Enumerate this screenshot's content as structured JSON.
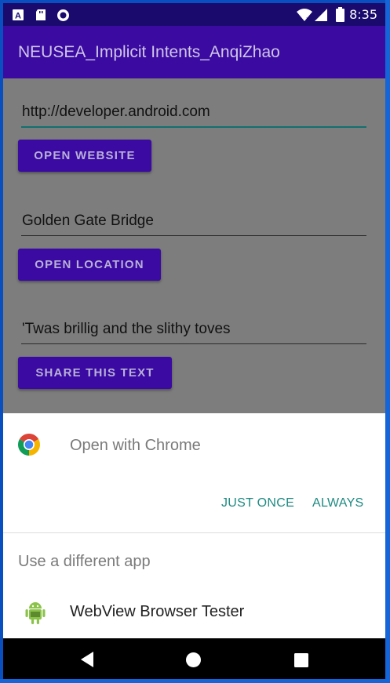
{
  "status_bar": {
    "time": "8:35",
    "icons": [
      "notification-a-icon",
      "sd-card-icon",
      "sync-circle-icon",
      "wifi-icon",
      "signal-icon",
      "battery-icon"
    ]
  },
  "app_bar": {
    "title": "NEUSEA_Implicit Intents_AnqiZhao"
  },
  "main": {
    "website_field": {
      "value": "http://developer.android.com"
    },
    "open_website_button": "OPEN WEBSITE",
    "location_field": {
      "value": "Golden Gate Bridge"
    },
    "open_location_button": "OPEN LOCATION",
    "share_field": {
      "value": "'Twas brillig and the slithy toves"
    },
    "share_text_button": "SHARE THIS TEXT"
  },
  "chooser": {
    "open_with_label": "Open with Chrome",
    "just_once": "JUST ONCE",
    "always": "ALWAYS",
    "different_app_label": "Use a different app",
    "apps": [
      {
        "name": "WebView Browser Tester",
        "icon": "android-robot-icon"
      }
    ]
  },
  "navigation": {
    "buttons": [
      "back-icon",
      "home-icon",
      "recents-icon"
    ]
  },
  "colors": {
    "app_bar": "#3b0aa0",
    "status_bar": "#1a0a6e",
    "button": "#3a0aa2",
    "accent_teal": "#1e8a82",
    "scrim": "#7d7d7d"
  }
}
